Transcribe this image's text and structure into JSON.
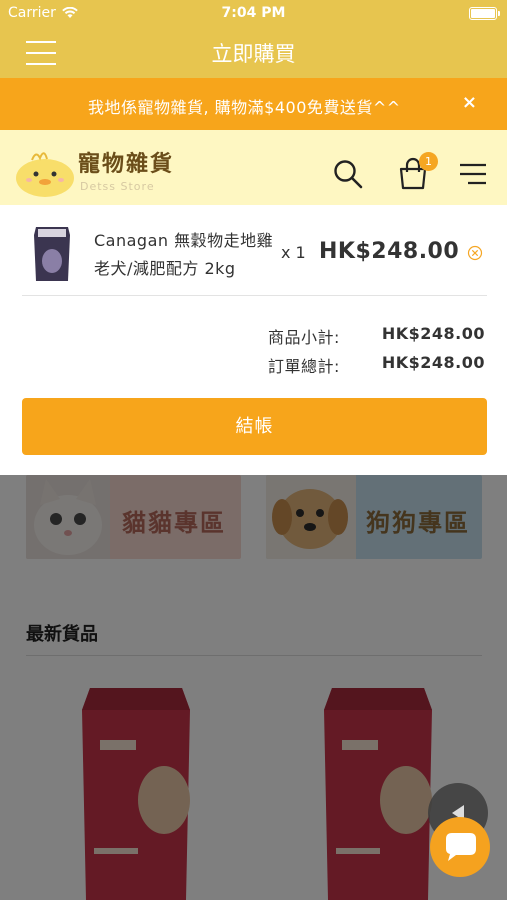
{
  "status_bar": {
    "carrier": "Carrier",
    "time": "7:04 PM"
  },
  "header": {
    "title": "立即購買"
  },
  "promo": {
    "text": "我地係寵物雜貨, 購物滿$400免費送貨^^",
    "close": "×"
  },
  "site": {
    "logo_name": "寵物雜貨",
    "logo_sub": "Detss Store",
    "cart_count": "1",
    "icons": [
      "search-icon",
      "cart-icon",
      "hamburger-icon"
    ]
  },
  "cart": {
    "item": {
      "name": "Canagan 無穀物走地雞老犬/減肥配方 2kg",
      "qty": "x 1",
      "price": "HK$248.00"
    },
    "subtotal_label": "商品小計:",
    "subtotal_value": "HK$248.00",
    "total_label": "訂單總計:",
    "total_value": "HK$248.00",
    "checkout_label": "結帳"
  },
  "background": {
    "banners": [
      {
        "label": "貓貓專區"
      },
      {
        "label": "狗狗專區"
      }
    ],
    "section_title": "最新貨品"
  },
  "colors": {
    "header": "#e7c54f",
    "promo": "#f7a51b",
    "site_header": "#fef7c2",
    "checkout": "#f7a51b"
  }
}
